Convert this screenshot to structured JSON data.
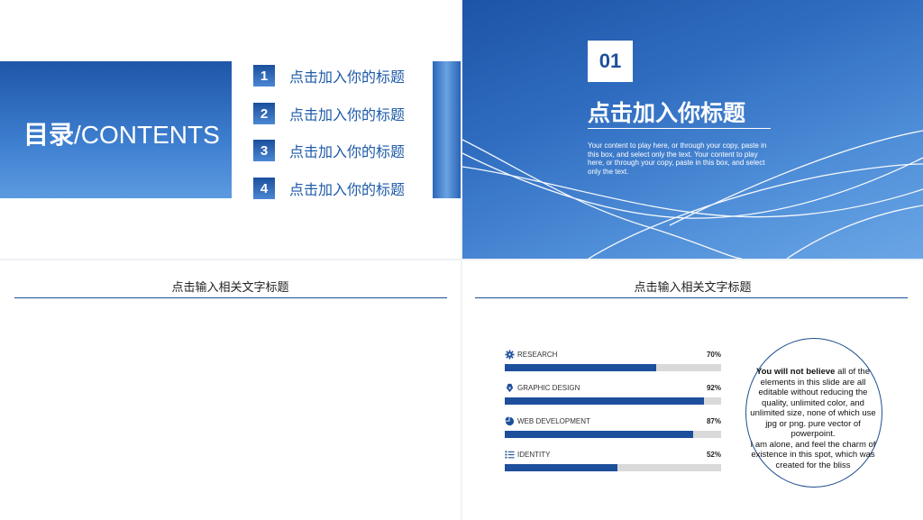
{
  "slide1": {
    "title_bold": "目录",
    "title_rest": "/CONTENTS",
    "items": [
      {
        "num": "1",
        "label": "点击加入你的标题"
      },
      {
        "num": "2",
        "label": "点击加入你的标题"
      },
      {
        "num": "3",
        "label": "点击加入你的标题"
      },
      {
        "num": "4",
        "label": "点击加入你的标题"
      }
    ]
  },
  "slide2": {
    "number": "01",
    "title": "点击加入你标题",
    "body": "Your content to play here, or through your copy, paste in this box, and select only the text. Your content to play here, or through your copy, paste in this box, and select only the text."
  },
  "slide3": {
    "title": "点击输入相关文字标题"
  },
  "slide4": {
    "title": "点击输入相关文字标题",
    "skills": [
      {
        "icon": "gear-icon",
        "name": "RESEARCH",
        "value": 70,
        "pct": "70%"
      },
      {
        "icon": "pen-nib-icon",
        "name": "GRAPHIC DESIGN",
        "value": 92,
        "pct": "92%"
      },
      {
        "icon": "pie-chart-icon",
        "name": "WEB DEVELOPMENT",
        "value": 87,
        "pct": "87%"
      },
      {
        "icon": "list-icon",
        "name": "IDENTITY",
        "value": 52,
        "pct": "52%"
      }
    ],
    "circle_bold": "You will not believe",
    "circle_text1": " all of the elements in this slide are all editable without reducing the quality, unlimited color, and unlimited size, none of which use jpg or png. pure vector of powerpoint.",
    "circle_text2": "I am alone, and feel the charm of existence in this spot, which was created for the bliss"
  },
  "colors": {
    "primary": "#1d4f9c",
    "accent_blue": "#1e5aa8",
    "track": "#d9d9d9"
  }
}
